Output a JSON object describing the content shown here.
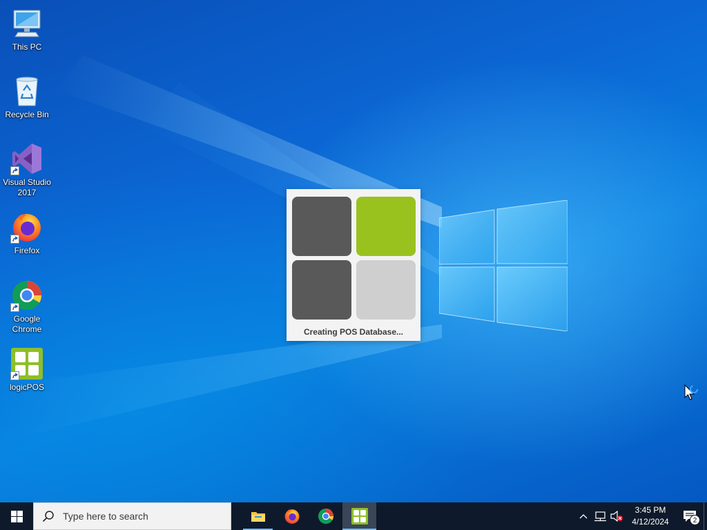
{
  "desktop": {
    "icons": [
      {
        "label": "This PC",
        "icon": "this-pc-icon"
      },
      {
        "label": "Recycle Bin",
        "icon": "recycle-bin-icon"
      },
      {
        "label": "Visual Studio 2017",
        "icon": "visual-studio-icon"
      },
      {
        "label": "Firefox",
        "icon": "firefox-icon"
      },
      {
        "label": "Google Chrome",
        "icon": "chrome-icon"
      },
      {
        "label": "logicPOS",
        "icon": "logicpos-icon"
      }
    ]
  },
  "splash": {
    "message": "Creating POS Database...",
    "tile_colors": [
      "#595959",
      "#99c21f",
      "#595959",
      "#cfcfcf"
    ]
  },
  "taskbar": {
    "search_placeholder": "Type here to search",
    "pinned": [
      {
        "name": "File Explorer",
        "icon": "folder-icon"
      },
      {
        "name": "Firefox",
        "icon": "firefox-icon"
      },
      {
        "name": "Google Chrome",
        "icon": "chrome-icon"
      },
      {
        "name": "logicPOS",
        "icon": "logicpos-icon",
        "active": true
      }
    ],
    "clock": {
      "time": "3:45 PM",
      "date": "4/12/2024"
    },
    "notification_count": "2"
  },
  "colors": {
    "accent": "#0a62c9",
    "logicpos_green": "#99c21f",
    "taskbar_bg": "#0e1a2b"
  }
}
